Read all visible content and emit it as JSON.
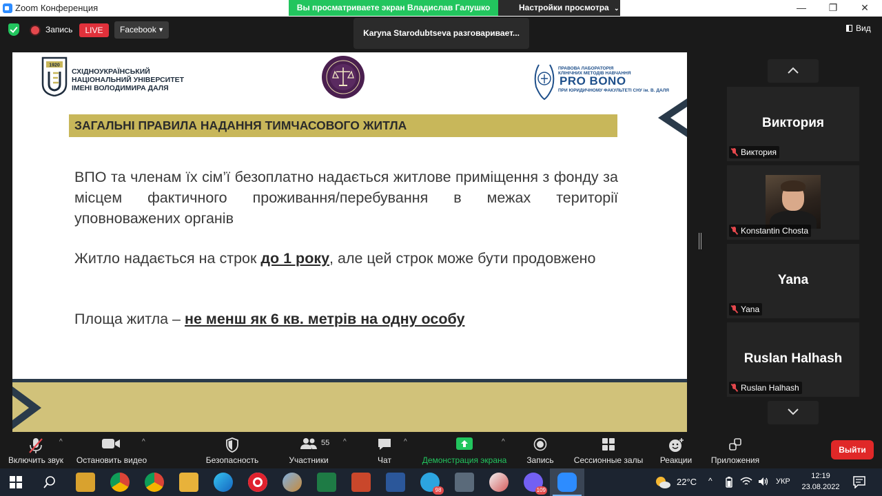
{
  "window": {
    "title": "Zoom Конференция",
    "share_banner": "Вы просматриваете экран Владислав Галушко",
    "view_settings": "Настройки просмотра",
    "controls": [
      "—",
      "❐",
      "✕"
    ]
  },
  "topbar": {
    "record_label": "Запись",
    "live_label": "LIVE",
    "stream_target": "Facebook",
    "speaking_banner": "Karyna Starodubtseva разговаривает...",
    "view_label": "Вид"
  },
  "slide": {
    "university_logo": {
      "year": "1920",
      "line1": "СХІДНОУКРАЇНСЬКИЙ",
      "line2": "НАЦІОНАЛЬНИЙ УНІВЕРСИТЕТ",
      "line3": "ІМЕНІ ВОЛОДИМИРА ДАЛЯ"
    },
    "probono_logo": {
      "line1": "ПРАВОВА ЛАБОРАТОРІЯ",
      "line2": "КЛІНІЧНИХ МЕТОДІВ НАВЧАННЯ",
      "name": "PRO BONO",
      "line3": "ПРИ ЮРИДИЧНОМУ ФАКУЛЬТЕТІ СНУ ім. В. ДАЛЯ"
    },
    "title": "ЗАГАЛЬНІ ПРАВИЛА НАДАННЯ ТИМЧАСОВОГО ЖИТЛА",
    "para1": "ВПО та членам їх сім’ї безоплатно надається житлове приміщення з фонду за місцем фактичного проживання/перебування в межах території уповноважених органів",
    "para2_before": "Житло надається на строк ",
    "para2_emph": "до 1 року",
    "para2_after": ", але цей строк може бути продовжено",
    "para3_before": "Площа житла – ",
    "para3_emph": "не менш як 6 кв. метрів на одну особу"
  },
  "participants": [
    {
      "display": "Виктория",
      "label": "Виктория",
      "video": false
    },
    {
      "display": "",
      "label": "Konstantin Chosta",
      "video": true
    },
    {
      "display": "Yana",
      "label": "Yana",
      "video": false
    },
    {
      "display": "Ruslan Halhash",
      "label": "Ruslan Halhash",
      "video": false
    }
  ],
  "toolbar": {
    "unmute": "Включить звук",
    "stop_video": "Остановить видео",
    "security": "Безопасность",
    "participants": "Участники",
    "participants_count": "55",
    "chat": "Чат",
    "share_screen": "Демонстрация экрана",
    "record": "Запись",
    "breakout": "Сессионные залы",
    "reactions": "Реакции",
    "apps": "Приложения",
    "leave": "Выйти"
  },
  "taskbar": {
    "telegram_badge": "98",
    "viber_badge": "109",
    "temperature": "22°C",
    "language": "УКР",
    "time": "12:19",
    "date": "23.08.2022"
  },
  "colors": {
    "accent_gold": "#c8b75a",
    "share_green": "#22c55e",
    "leave_red": "#e02828",
    "slide_navy": "#2a3a4a"
  }
}
